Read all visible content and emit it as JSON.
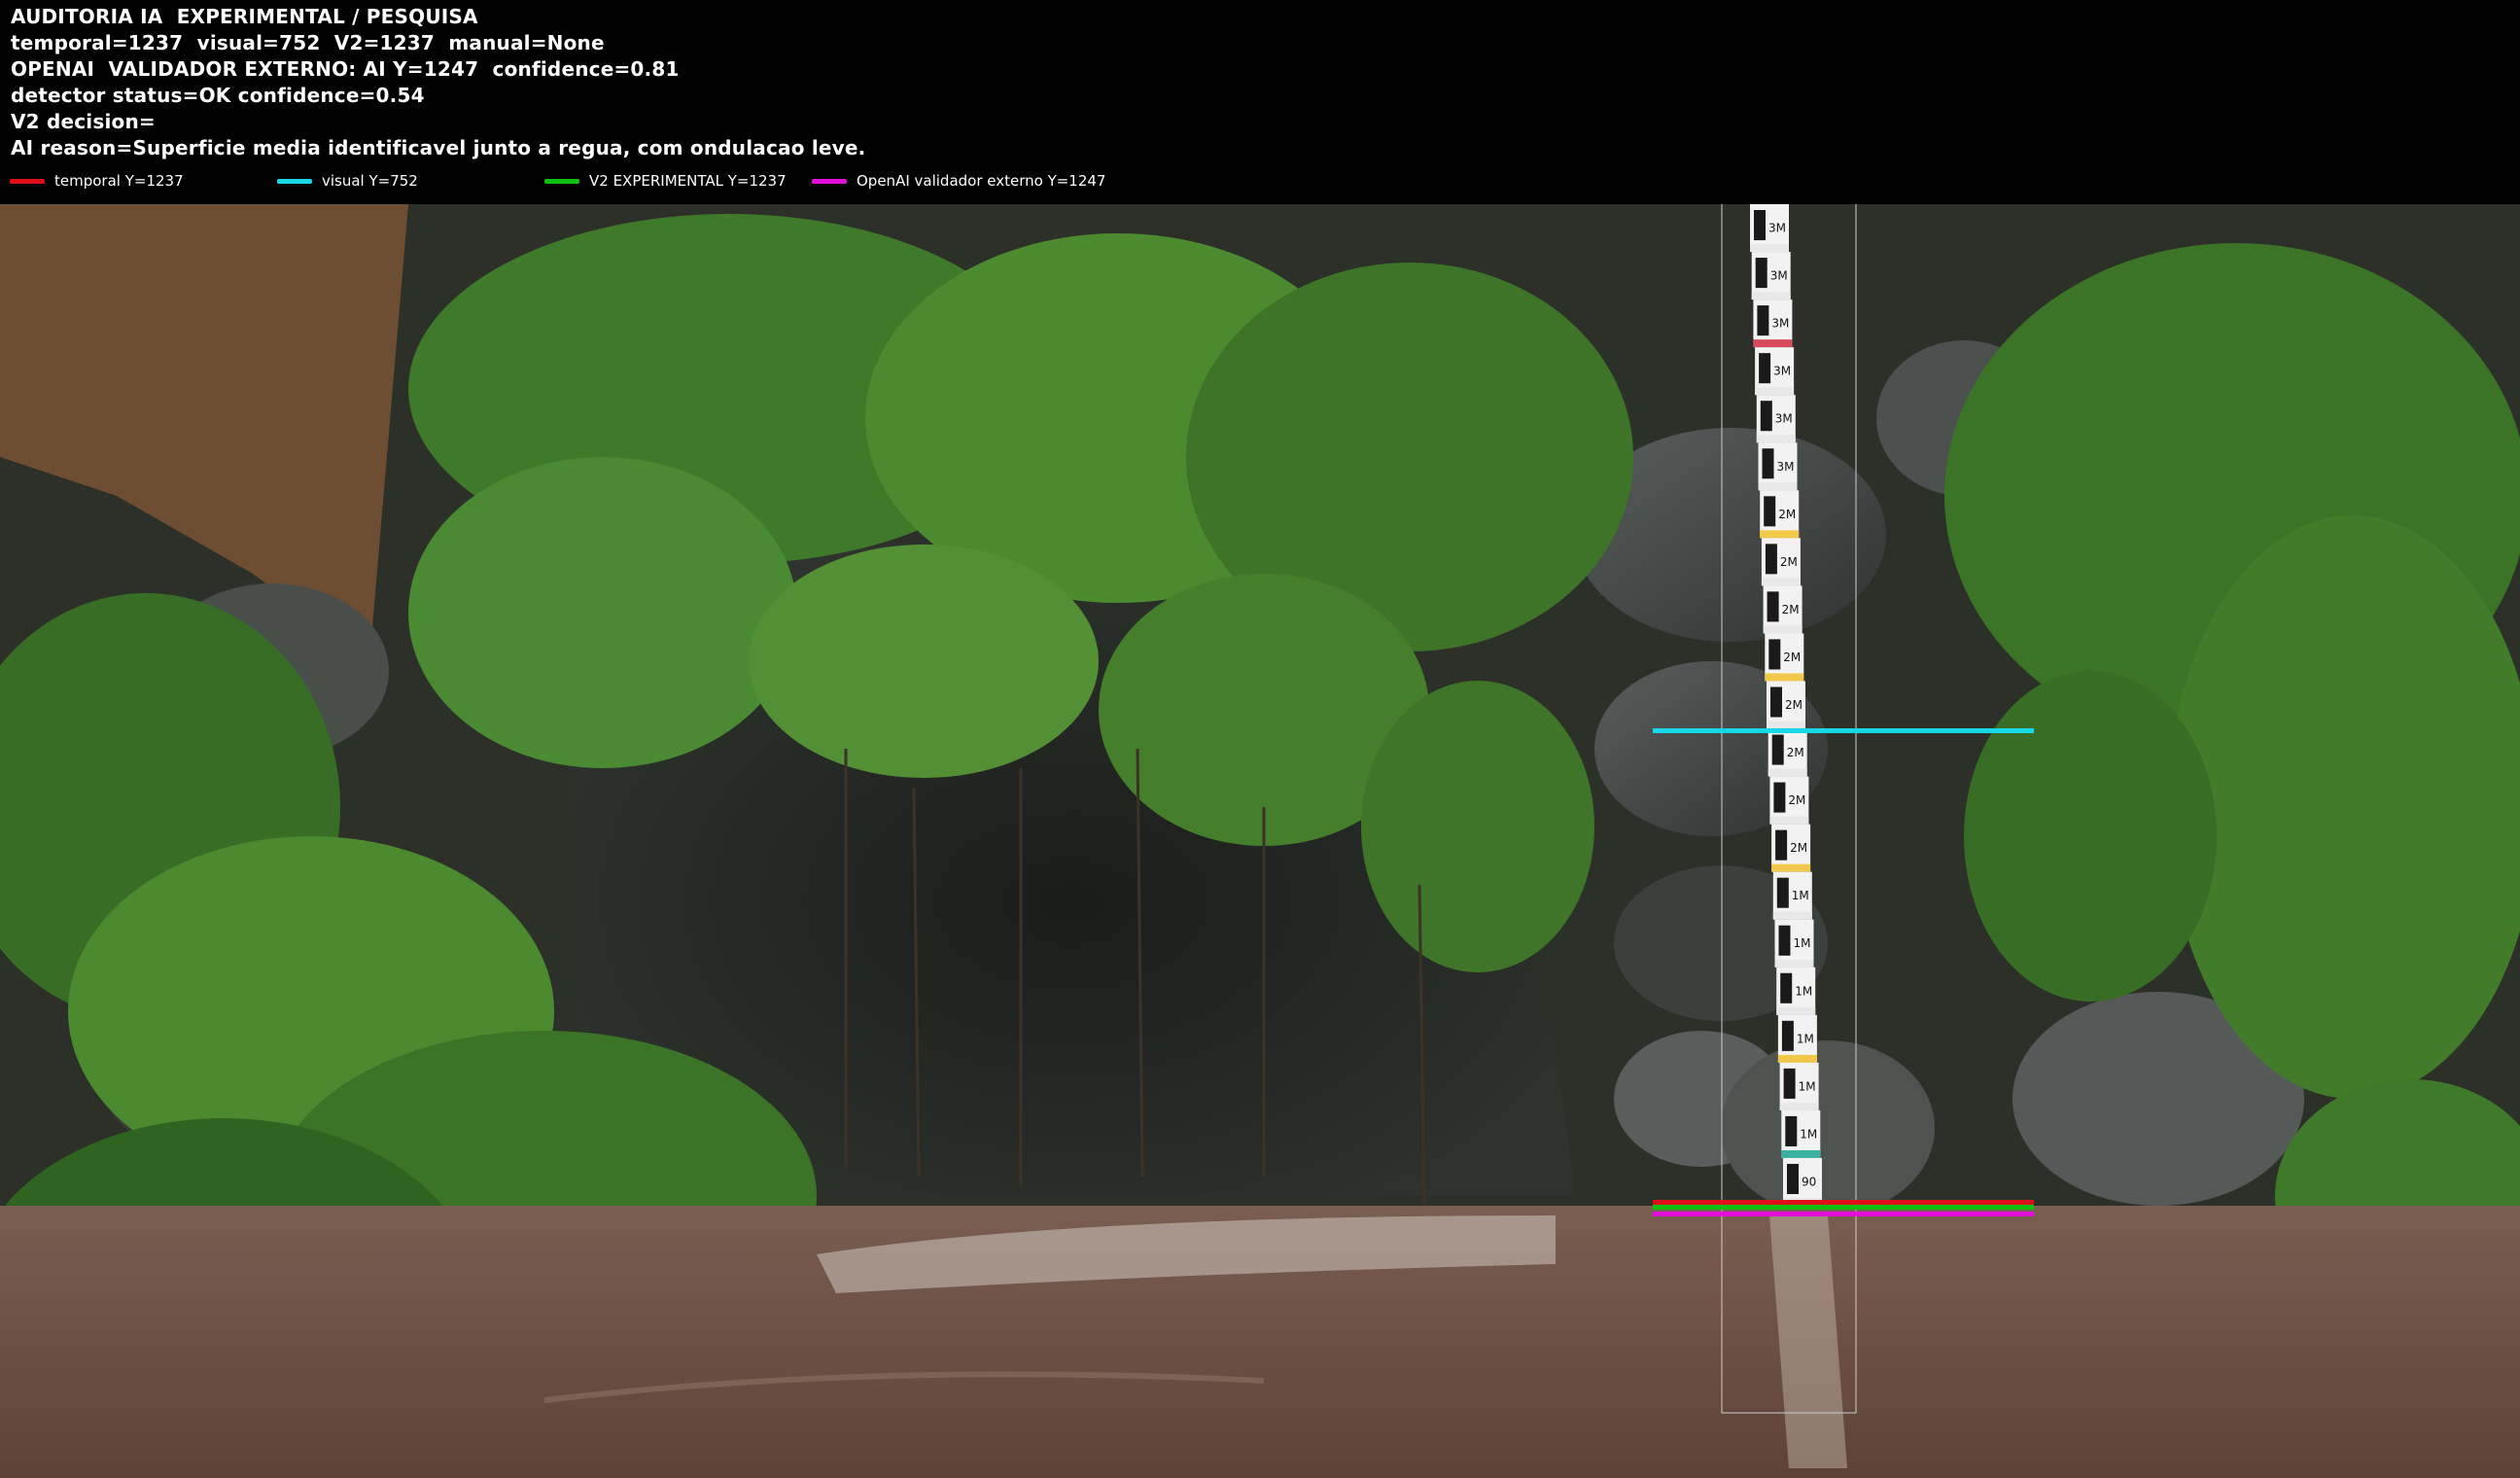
{
  "header": {
    "lines": [
      "AUDITORIA IA  EXPERIMENTAL / PESQUISA",
      "temporal=1237  visual=752  V2=1237  manual=None",
      "OPENAI  VALIDADOR EXTERNO: AI Y=1247  confidence=0.81",
      "detector status=OK confidence=0.54",
      "V2 decision=",
      "AI reason=Superficie media identificavel junto a regua, com ondulacao leve."
    ]
  },
  "legend": [
    {
      "label": "temporal Y=1237",
      "color": "#e0101a"
    },
    {
      "label": "visual Y=752",
      "color": "#18d8e8"
    },
    {
      "label": "V2 EXPERIMENTAL Y=1237",
      "color": "#10c010"
    },
    {
      "label": "OpenAI validador externo Y=1247",
      "color": "#e010d8"
    }
  ],
  "gauge": {
    "markings": [
      "3M",
      "3M",
      "3M",
      "3M",
      "3M",
      "3M",
      "2M",
      "2M",
      "2M",
      "2M",
      "2M",
      "2M",
      "2M",
      "2M",
      "1M",
      "1M",
      "1M",
      "1M",
      "1M",
      "1M",
      "90"
    ]
  },
  "colors": {
    "temporal": "#e0101a",
    "visual": "#18d8e8",
    "v2": "#10c010",
    "openai": "#e010d8"
  },
  "icons": {
    "header": "overlay-text",
    "scene": "river-gauge-photo"
  }
}
